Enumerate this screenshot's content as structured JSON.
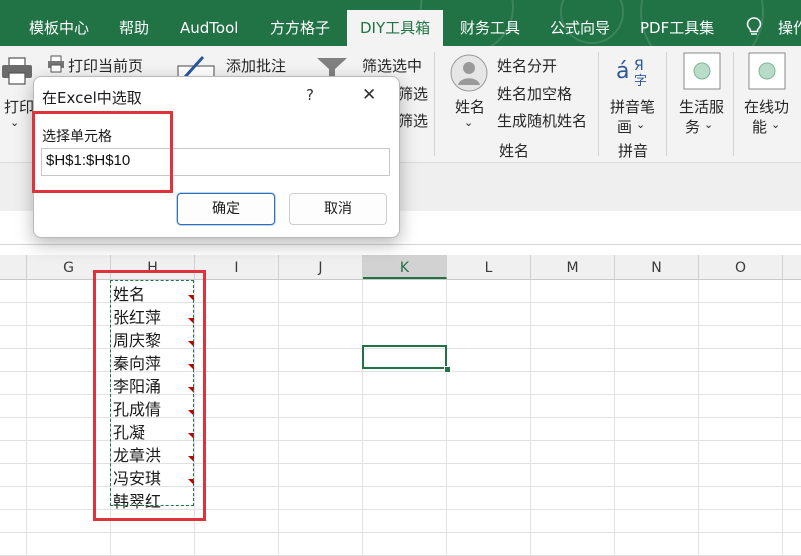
{
  "tabs": [
    {
      "label": "模板中心"
    },
    {
      "label": "帮助"
    },
    {
      "label": "AudTool"
    },
    {
      "label": "方方格子"
    },
    {
      "label": "DIY工具箱",
      "active": true
    },
    {
      "label": "财务工具"
    },
    {
      "label": "公式向导"
    },
    {
      "label": "PDF工具集"
    },
    {
      "label": "操作"
    }
  ],
  "ribbon": {
    "print_label": "打印",
    "print_current_label": "打印当前页",
    "add_comment_label": "添加批注",
    "filter_selected_label": "筛选选中",
    "filter_2_label": "筛选",
    "filter_3_label": "筛选",
    "name_group": {
      "big_label": "姓名",
      "split_label": "姓名分开",
      "add_space_label": "姓名加空格",
      "random_label": "生成随机姓名",
      "group_label": "姓名"
    },
    "pinyin": {
      "button_line1": "拼音笔",
      "button_line2": "画",
      "group_label": "拼音"
    },
    "life_service": {
      "line1": "生活服",
      "line2": "务"
    },
    "online_func": {
      "line1": "在线功",
      "line2": "能"
    }
  },
  "dialog": {
    "title": "在Excel中选取",
    "help": "?",
    "close": "✕",
    "field_label": "选择单元格",
    "field_value": "$H$1:$H$10",
    "ok": "确定",
    "cancel": "取消"
  },
  "columns": [
    "G",
    "H",
    "I",
    "J",
    "K",
    "L",
    "M",
    "N",
    "O"
  ],
  "selected_column": "K",
  "cells_H": [
    "姓名",
    "张红萍",
    "周庆黎",
    "秦向萍",
    "李阳涌",
    "孔成倩",
    "孔凝",
    "龙章洪",
    "冯安琪",
    "韩翠红"
  ],
  "colors": {
    "accent": "#217346",
    "highlight": "#e0323a",
    "comment_marker": "#c00000"
  }
}
